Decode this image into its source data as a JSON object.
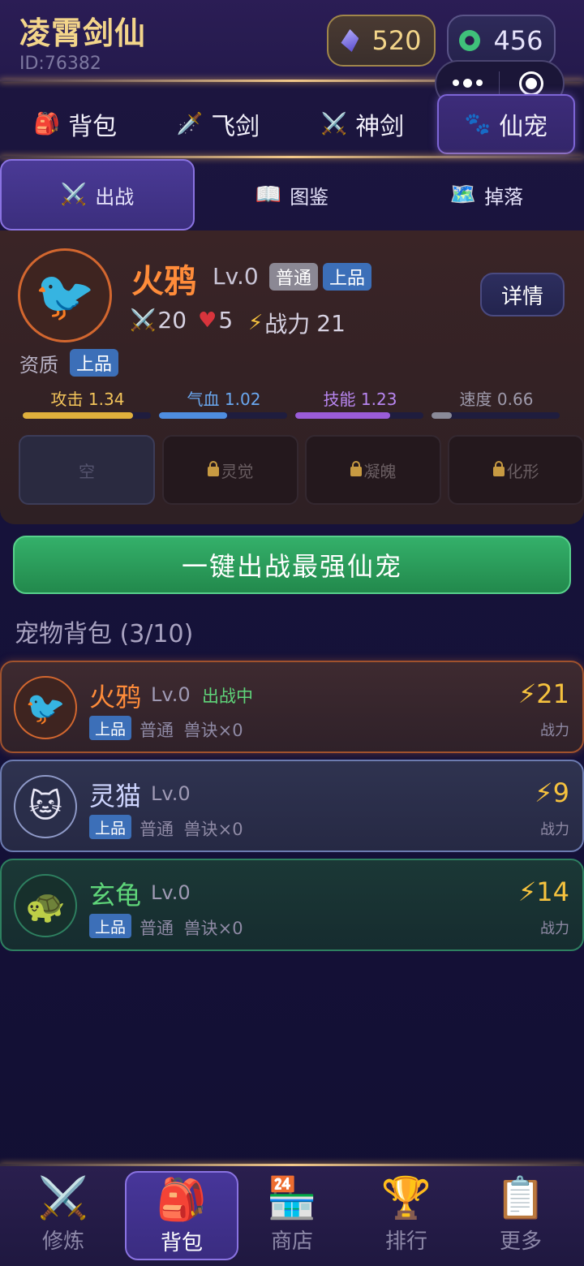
{
  "header": {
    "title": "凌霄剑仙",
    "player_id": "ID:76382",
    "gem_amount": "520",
    "jade_amount": "456"
  },
  "main_tabs": [
    {
      "label": "背包",
      "icon": "🎒"
    },
    {
      "label": "飞剑",
      "icon": "🗡️"
    },
    {
      "label": "神剑",
      "icon": "⚔️"
    },
    {
      "label": "仙宠",
      "icon": "🐾"
    }
  ],
  "sub_tabs": [
    {
      "label": "出战",
      "icon": "⚔️"
    },
    {
      "label": "图鉴",
      "icon": "📖"
    },
    {
      "label": "掉落",
      "icon": "🗺️"
    }
  ],
  "active_pet": {
    "avatar": "🐦",
    "name": "火鸦",
    "level": "Lv.0",
    "type_badge": "普通",
    "grade_badge": "上品",
    "detail_label": "详情",
    "attack": "20",
    "hp": "5",
    "power_label": "战力",
    "power": "21",
    "aptitude_label": "资质",
    "aptitude_value": "上品",
    "growth": [
      {
        "label": "攻击 1.34",
        "value": 1.34,
        "fill": 0.86,
        "color": "#e0b03c",
        "text_color": "#f3c45a"
      },
      {
        "label": "气血 1.02",
        "value": 1.02,
        "fill": 0.53,
        "color": "#4e8de0",
        "text_color": "#6aa8f0"
      },
      {
        "label": "技能 1.23",
        "value": 1.23,
        "fill": 0.74,
        "color": "#9a5cd8",
        "text_color": "#b886f0"
      },
      {
        "label": "速度 0.66",
        "value": 0.66,
        "fill": 0.16,
        "color": "#8a8a98",
        "text_color": "#9e9aab"
      }
    ],
    "slots": [
      {
        "label": "空",
        "locked": false
      },
      {
        "label": "灵觉",
        "locked": true
      },
      {
        "label": "凝魄",
        "locked": true
      },
      {
        "label": "化形",
        "locked": true
      }
    ]
  },
  "deploy_button": "一键出战最强仙宠",
  "bag_title": "宠物背包 (3/10)",
  "pets": [
    {
      "avatar": "🐦",
      "name": "火鸦",
      "name_color": "#ff8c3a",
      "level": "Lv.0",
      "status": "出战中",
      "grade": "上品",
      "meta": "普通 兽诀×0",
      "power": "⚡21",
      "power_label": "战力"
    },
    {
      "avatar": "🐱",
      "name": "灵猫",
      "name_color": "#cfd6ff",
      "level": "Lv.0",
      "status": "",
      "grade": "上品",
      "meta": "普通 兽诀×0",
      "power": "⚡9",
      "power_label": "战力"
    },
    {
      "avatar": "🐢",
      "name": "玄龟",
      "name_color": "#5fd67a",
      "level": "Lv.0",
      "status": "",
      "grade": "上品",
      "meta": "普通 兽诀×0",
      "power": "⚡14",
      "power_label": "战力"
    }
  ],
  "bottom_nav": [
    {
      "label": "修炼",
      "icon": "⚔️"
    },
    {
      "label": "背包",
      "icon": "🎒"
    },
    {
      "label": "商店",
      "icon": "🏪"
    },
    {
      "label": "排行",
      "icon": "🏆"
    },
    {
      "label": "更多",
      "icon": "📋"
    }
  ]
}
